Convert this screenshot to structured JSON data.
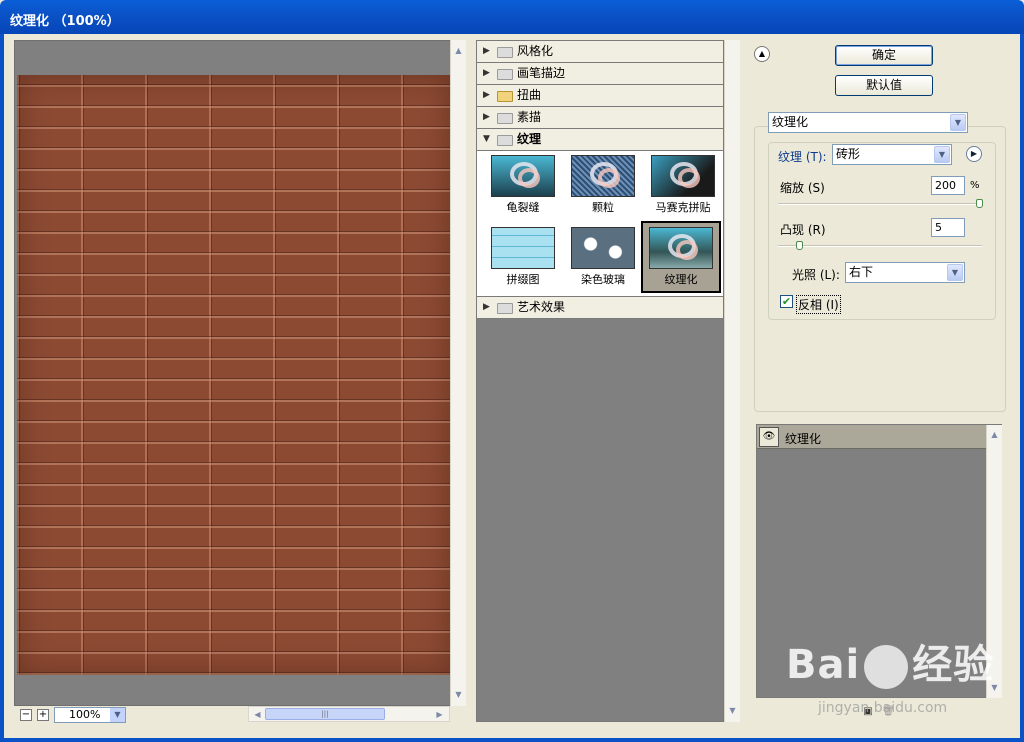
{
  "window": {
    "title": "纹理化 （100%）"
  },
  "preview": {
    "zoom_value": "100%",
    "zoom_out": "−",
    "zoom_in": "+"
  },
  "filters": {
    "categories": [
      {
        "label": "风格化",
        "expanded": false
      },
      {
        "label": "画笔描边",
        "expanded": false
      },
      {
        "label": "扭曲",
        "expanded": false
      },
      {
        "label": "素描",
        "expanded": false
      },
      {
        "label": "纹理",
        "expanded": true
      },
      {
        "label": "艺术效果",
        "expanded": false
      }
    ],
    "texture_items": [
      {
        "label": "龟裂缝"
      },
      {
        "label": "颗粒"
      },
      {
        "label": "马赛克拼贴"
      },
      {
        "label": "拼缀图"
      },
      {
        "label": "染色玻璃"
      },
      {
        "label": "纹理化",
        "selected": true
      }
    ]
  },
  "buttons": {
    "ok": "确定",
    "default": "默认值"
  },
  "settings": {
    "filter_select": "纹理化",
    "texture_label": "纹理 (T):",
    "texture_value": "砖形",
    "scale_label": "缩放 (S)",
    "scale_value": "200",
    "scale_unit": "%",
    "relief_label": "凸现 (R)",
    "relief_value": "5",
    "light_label": "光照 (L):",
    "light_value": "右下",
    "invert_label": "反相 (I)",
    "invert_checked": true
  },
  "layers": {
    "items": [
      {
        "name": "纹理化",
        "visible": true
      }
    ]
  },
  "watermark": {
    "brand": "Bai",
    "brand2": "经验",
    "sub": "jingyan.baidu.com"
  },
  "colors": {
    "title_bar": "#0b52c7",
    "brick": "#8c4a33",
    "accent_check": "#219321"
  }
}
